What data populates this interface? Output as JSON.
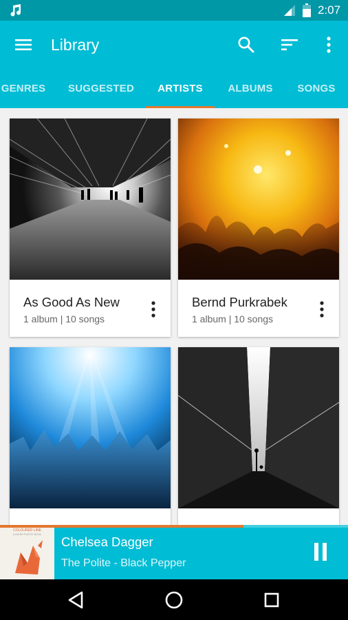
{
  "status_bar": {
    "time": "2:07"
  },
  "toolbar": {
    "title": "Library"
  },
  "tabs": [
    {
      "label": "GENRES",
      "active": false
    },
    {
      "label": "SUGGESTED",
      "active": false
    },
    {
      "label": "ARTISTS",
      "active": true
    },
    {
      "label": "ALBUMS",
      "active": false
    },
    {
      "label": "SONGS",
      "active": false
    }
  ],
  "artists": [
    {
      "name": "As Good As New",
      "meta": "1 album | 10 songs"
    },
    {
      "name": "Bernd Purkrabek",
      "meta": "1 album | 10 songs"
    },
    {
      "name": "",
      "meta": ""
    },
    {
      "name": "",
      "meta": ""
    }
  ],
  "now_playing": {
    "title": "Chelsea Dagger",
    "subtitle": "The Polite - Black Pepper",
    "progress": 0.7,
    "album_art_text": [
      "COLOURED LINE",
      "A PAPER POETRY BOOK"
    ]
  },
  "colors": {
    "primary": "#00bcd4",
    "status_bar": "#0097a7",
    "accent": "#e3782f"
  },
  "icons": {
    "status": [
      "music-note-icon",
      "signal-icon",
      "battery-icon"
    ],
    "toolbar": [
      "menu-icon",
      "search-icon",
      "sort-icon",
      "more-vert-icon"
    ],
    "player": [
      "pause-icon"
    ],
    "nav": [
      "back-icon",
      "home-icon",
      "recents-icon"
    ]
  }
}
